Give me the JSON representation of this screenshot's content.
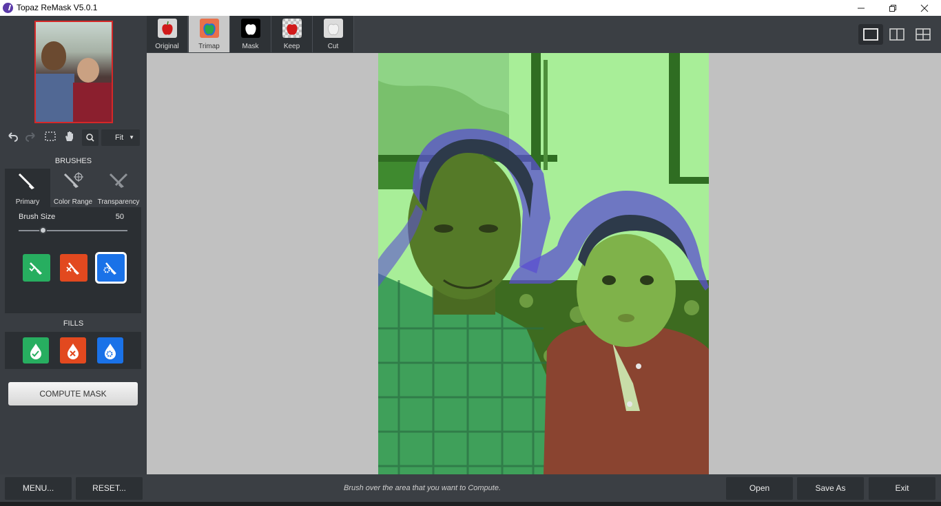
{
  "window": {
    "title": "Topaz ReMask V5.0.1",
    "minimize_icon": "minimize-icon",
    "restore_icon": "restore-icon",
    "close_icon": "close-icon"
  },
  "toolbar_left": {
    "zoom_value": "Fit"
  },
  "brushes": {
    "section_label": "BRUSHES",
    "tabs": [
      {
        "label": "Primary"
      },
      {
        "label": "Color Range"
      },
      {
        "label": "Transparency"
      }
    ],
    "brush_size_label": "Brush Size",
    "brush_size_value": "50",
    "slider_value_fraction": 0.22,
    "buttons": [
      {
        "name": "keep-brush",
        "color": "#27ae60"
      },
      {
        "name": "cut-brush",
        "color": "#e2491f"
      },
      {
        "name": "compute-brush",
        "color": "#1a72e8",
        "selected": true
      }
    ]
  },
  "fills": {
    "section_label": "FILLS",
    "buttons": [
      {
        "name": "keep-fill",
        "color": "#27ae60"
      },
      {
        "name": "cut-fill",
        "color": "#e2491f"
      },
      {
        "name": "compute-fill",
        "color": "#1a72e8"
      }
    ]
  },
  "compute_button": "COMPUTE MASK",
  "view_tabs": [
    {
      "label": "Original"
    },
    {
      "label": "Trimap",
      "active": true
    },
    {
      "label": "Mask"
    },
    {
      "label": "Keep"
    },
    {
      "label": "Cut"
    }
  ],
  "bottom": {
    "menu_label": "MENU...",
    "reset_label": "RESET...",
    "hint": "Brush over the area that you want to Compute.",
    "open_label": "Open",
    "save_as_label": "Save As",
    "exit_label": "Exit"
  },
  "colors": {
    "keep": "#27ae60",
    "cut": "#e2491f",
    "compute": "#1a72e8",
    "trimap_keep_overlay": "#7fd85a",
    "trimap_compute_overlay": "#5a4fd8"
  }
}
